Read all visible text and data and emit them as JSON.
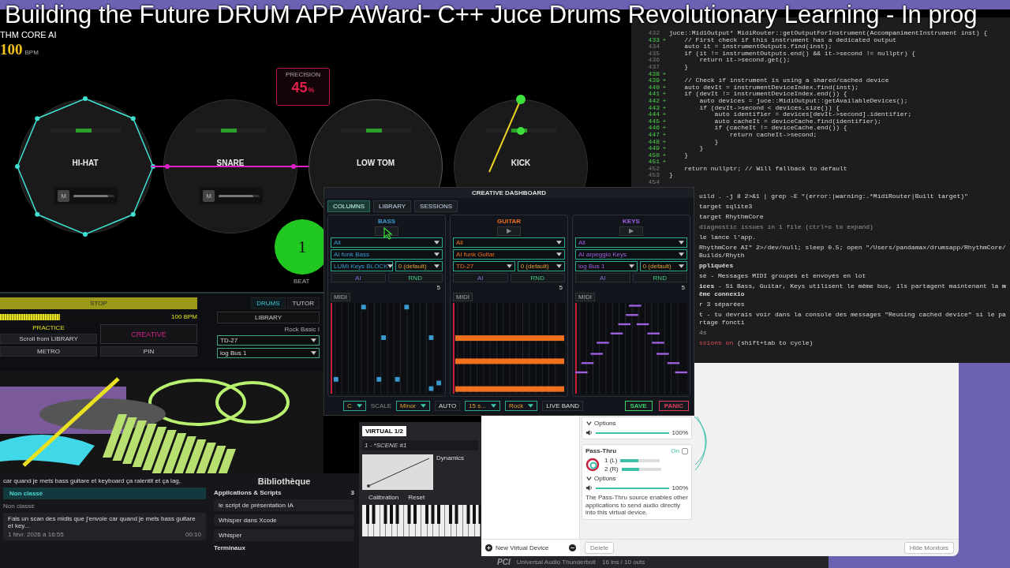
{
  "video_title": "Building the Future DRUM APP AWard- C++ Juce Drums Revolutionary Learning - In prog",
  "drum_app": {
    "app_name": "THM CORE AI",
    "tempo": "100",
    "tempo_unit": "BPM",
    "precision": {
      "label": "PRECISION",
      "value": "45",
      "unit": "%"
    },
    "pads": [
      {
        "label": "HI-HAT",
        "kind": "octagon",
        "color": "#3ee0d0",
        "button": "M",
        "level": 0.85
      },
      {
        "label": "SNARE",
        "kind": "line",
        "color": "#e020c8",
        "button": "M",
        "level": 0.85
      },
      {
        "label": "LOW TOM",
        "kind": "plain",
        "color": "#5a5a5a"
      },
      {
        "label": "KICK",
        "kind": "needle",
        "color": "#e8d020"
      }
    ],
    "beat": {
      "value": "1",
      "label": "BEAT"
    }
  },
  "lower_panel": {
    "tabs": [
      {
        "label": "DRUMS",
        "selected": true
      },
      {
        "label": "TUTOR",
        "selected": false
      }
    ],
    "stop": "STOP",
    "progress": {
      "level": 0.36
    },
    "bpm": "100 BPM",
    "practice_label": "PRACTICE",
    "scroll_hint": "Scroll from LIBRARY",
    "metro": "METRO",
    "creative": "CREATIVE",
    "pin": "PIN",
    "library": "LIBRARY",
    "preset": "Rock Basic I",
    "selects": [
      "TD-27",
      "log Bus 1"
    ]
  },
  "editor": {
    "lines": [
      {
        "number": "432",
        "added": false,
        "text": "juce::MidiOutput* MidiRouter::getOutputForInstrument(AccompanimentInstrument inst) {"
      },
      {
        "number": "433",
        "marker": "+",
        "added": true,
        "text": "    // First check if this instrument has a dedicated output"
      },
      {
        "number": "434",
        "added": false,
        "text": "    auto it = instrumentOutputs.find(inst);"
      },
      {
        "number": "435",
        "added": false,
        "text": "    if (it != instrumentOutputs.end() && it->second != nullptr) {"
      },
      {
        "number": "436",
        "added": false,
        "text": "        return it->second.get();"
      },
      {
        "number": "437",
        "added": false,
        "text": "    }"
      },
      {
        "number": "438",
        "marker": "+",
        "added": true
      },
      {
        "number": "439",
        "marker": "+",
        "added": true,
        "text": "    // Check if instrument is using a shared/cached device"
      },
      {
        "number": "440",
        "marker": "+",
        "added": true,
        "text": "    auto devIt = instrumentDeviceIndex.find(inst);"
      },
      {
        "number": "441",
        "marker": "+",
        "added": true,
        "text": "    if (devIt != instrumentDeviceIndex.end()) {"
      },
      {
        "number": "442",
        "marker": "+",
        "added": true,
        "text": "        auto devices = juce::MidiOutput::getAvailableDevices();"
      },
      {
        "number": "443",
        "marker": "+",
        "added": true,
        "text": "        if (devIt->second < devices.size()) {"
      },
      {
        "number": "444",
        "marker": "+",
        "added": true,
        "text": "            auto identifier = devices[devIt->second].identifier;"
      },
      {
        "number": "445",
        "marker": "+",
        "added": true,
        "text": "            auto cacheIt = deviceCache.find(identifier);"
      },
      {
        "number": "446",
        "marker": "+",
        "added": true,
        "text": "            if (cacheIt != deviceCache.end()) {"
      },
      {
        "number": "447",
        "marker": "+",
        "added": true,
        "text": "                return cacheIt->second;"
      },
      {
        "number": "448",
        "marker": "+",
        "added": true,
        "text": "            }"
      },
      {
        "number": "449",
        "marker": "+",
        "added": true,
        "text": "        }"
      },
      {
        "number": "450",
        "marker": "+",
        "added": true,
        "text": "    }"
      },
      {
        "number": "451",
        "marker": "+",
        "added": true
      },
      {
        "number": "452",
        "added": false,
        "text": "    return nullptr; // Will fallback to default"
      },
      {
        "number": "453",
        "added": false,
        "text": "}"
      },
      {
        "number": "454",
        "added": false
      }
    ]
  },
  "terminal": {
    "lines": [
      {
        "kind": "plain",
        "text": "uild . -j 8 2>&1 | grep -E \"(error:|warning:.*MidiRouter|Built target)\""
      },
      {
        "kind": "plain",
        "text": "target sqlite3"
      },
      {
        "kind": "plain",
        "text": "target RhythmCore"
      },
      {
        "kind": "dim",
        "text": "diagnostic issues in 1 file (ctrl+o to expand)"
      },
      {
        "kind": "plain",
        "text": "le lance l'app."
      },
      {
        "kind": "plain",
        "text": "RhythmCore AI\" 2>/dev/null; sleep 0.5; open \"/Users/pandamax/drumsapp/RhythmCore/Builds/Rhyth"
      },
      {
        "kind": "bold",
        "text": "ppliquées"
      },
      {
        "kind": "plain",
        "text": "sé - Messages MIDI groupés et envoyés en lot"
      },
      {
        "kind": "plain",
        "text": "**ices** - Si Bass, Guitar, Keys utilisent le même bus, ils partagent maintenant la **même connexio**"
      },
      {
        "kind": "plain",
        "text": "r 3 séparées"
      },
      {
        "kind": "plain",
        "text": "t - tu devrais voir dans la console des messages \"Reusing cached device\" si le partage foncti"
      },
      {
        "kind": "dim",
        "text": "4s"
      },
      {
        "kind": "mode",
        "accent": "ssions on",
        "text": "(shift+tab to cycle)"
      }
    ]
  },
  "dashboard": {
    "title": "CREATIVE DASHBOARD",
    "tabs": [
      {
        "label": "COLUMNS",
        "selected": true
      },
      {
        "label": "LIBRARY",
        "selected": false
      },
      {
        "label": "SESSIONS",
        "selected": false
      }
    ],
    "columns": [
      {
        "name": "BASS",
        "color": "#3a9ad0",
        "kind": "blocks",
        "selects": [
          "All",
          "AI funk Bass",
          "LUMI Keys BLOCK",
          "0 (default)"
        ],
        "ai": "AI",
        "rnd": "RND",
        "value": "5",
        "midi": "MIDI"
      },
      {
        "name": "GUITAR",
        "color": "#f07020",
        "kind": "bars",
        "play": "▶",
        "selects": [
          "All",
          "AI funk Guitar",
          "TD-27",
          "0 (default)"
        ],
        "ai": "AI",
        "rnd": "RND",
        "value": "5",
        "midi": "MIDI"
      },
      {
        "name": "KEYS",
        "color": "#a060e0",
        "kind": "steps",
        "play": "▶",
        "selects": [
          "All",
          "AI arpeggio Keys",
          "log Bus 1",
          "0 (default)"
        ],
        "ai": "AI",
        "rnd": "RND",
        "value": "5",
        "midi": "MIDI"
      }
    ],
    "bottom": [
      {
        "kind": "select",
        "text": "C"
      },
      {
        "kind": "label",
        "text": "SCALE"
      },
      {
        "kind": "select",
        "text": "Minor"
      },
      {
        "kind": "button",
        "text": "AUTO"
      },
      {
        "kind": "select",
        "text": "15 s..."
      },
      {
        "kind": "select",
        "text": "Rock"
      },
      {
        "kind": "button",
        "text": "LIVE BAND"
      }
    ],
    "actions": [
      {
        "label": "SAVE",
        "color": "#3ccf6a"
      },
      {
        "label": "PANIC",
        "color": "#e0405a"
      }
    ]
  },
  "notes": {
    "preview": "car quand je mets bass guitare et keyboard ça ralentit et ça lag,",
    "category": "Non classé",
    "section": "Non classé",
    "item": {
      "title": "Fais un scan des midis que j'envoie car quand je mets bass guitare et key...",
      "date": "1 févr. 2026 à 16:55",
      "duration": "00:10"
    },
    "library": {
      "title": "Bibliothèque",
      "group": "Applications & Scripts",
      "count": "3",
      "items": [
        "le script de présentation IA",
        "Whisper dans Xcode",
        "Whisper"
      ],
      "footer": "Terminaux"
    }
  },
  "plugin": {
    "tab": "VIRTUAL 1/2",
    "scene": "1 - *SCENE #1",
    "dynamics": "Dynamics",
    "buttons": [
      "Calibration",
      "Reset"
    ]
  },
  "loopback": {
    "cards": [
      {
        "kind": "partial",
        "options": "Options",
        "level": 1,
        "reading": "100%"
      },
      {
        "kind": "source",
        "title": "Pass-Thru",
        "toggle": {
          "label": "On",
          "on": false
        },
        "channels": [
          {
            "label": "1 (L)",
            "level": 0.45
          },
          {
            "label": "2 (R)",
            "level": 0.45
          }
        ],
        "options": "Options",
        "level": 1,
        "reading": "100%",
        "description": "The Pass-Thru source enables other applications to send audio directly into this virtual device."
      }
    ],
    "new_device": "New Virtual Device",
    "delete": "Delete",
    "hide": "Hide Monitors"
  },
  "device_strip": {
    "bus": "PCI",
    "name": "Universal Audio Thunderbolt",
    "io": "16 ins / 10 outs"
  }
}
